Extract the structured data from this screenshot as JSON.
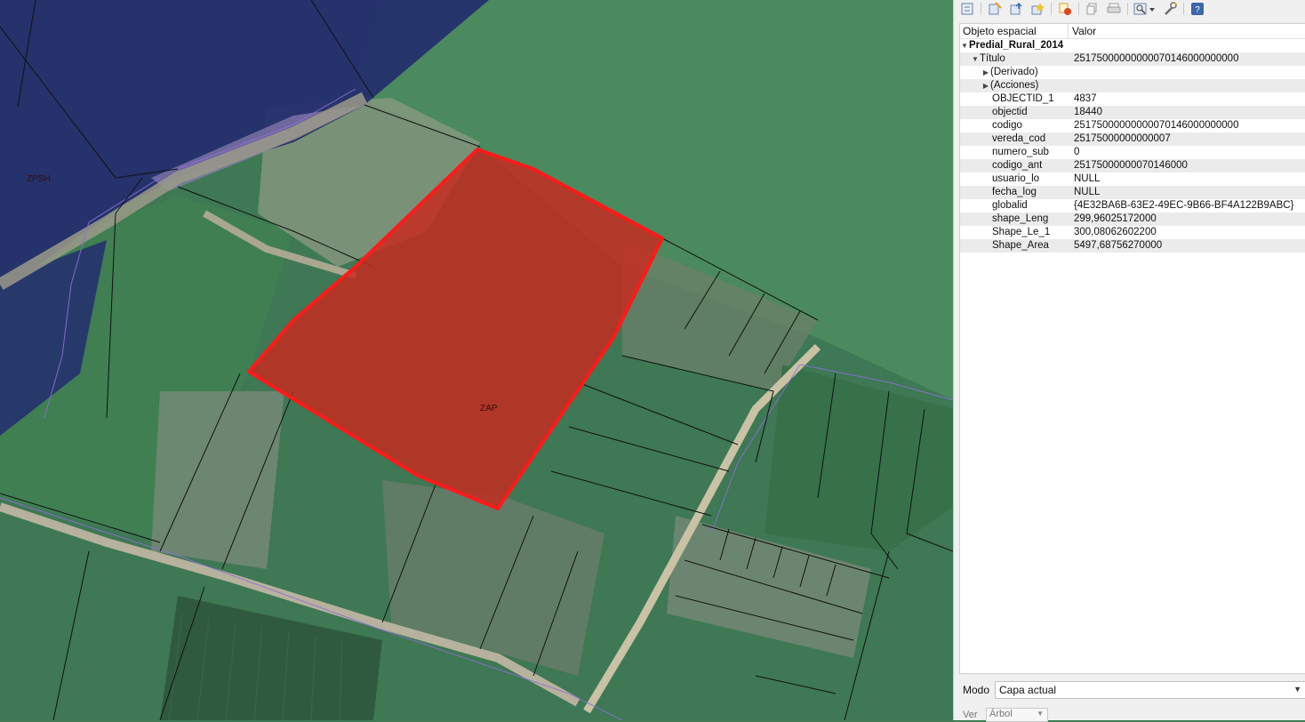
{
  "map": {
    "label_zpsh": "ZPSH",
    "label_zap": "ZAP",
    "colors": {
      "pasture": "#3f7a55",
      "pasture_light": "#4b8a5d",
      "protected_zone": "#1f2a6b",
      "selected_fill": "#c8281e",
      "selected_stroke": "#ff0000",
      "road": "#b9b39a"
    }
  },
  "toolbar": {
    "icons": [
      "expand-tree-icon",
      "expand-new-icon",
      "collapse-icon",
      "highlight-icon",
      "deselect-icon",
      "copy-icon",
      "print-icon",
      "identify-mode-icon",
      "settings-wrench-icon",
      "help-icon"
    ]
  },
  "identify": {
    "col_feature": "Objeto espacial",
    "col_value": "Valor",
    "layer_name": "Predial_Rural_2014",
    "title_key": "Título",
    "title_value": "25175000000000070146000000000",
    "derived": "(Derivado)",
    "actions": "(Acciones)",
    "attributes": [
      {
        "key": "OBJECTID_1",
        "value": "4837"
      },
      {
        "key": "objectid",
        "value": "18440"
      },
      {
        "key": "codigo",
        "value": "25175000000000070146000000000"
      },
      {
        "key": "vereda_cod",
        "value": "25175000000000007"
      },
      {
        "key": "numero_sub",
        "value": "0"
      },
      {
        "key": "codigo_ant",
        "value": "25175000000070146000"
      },
      {
        "key": "usuario_lo",
        "value": "NULL"
      },
      {
        "key": "fecha_log",
        "value": "NULL"
      },
      {
        "key": "globalid",
        "value": "{4E32BA6B-63E2-49EC-9B66-BF4A122B9ABC}"
      },
      {
        "key": "shape_Leng",
        "value": "299,96025172000"
      },
      {
        "key": "Shape_Le_1",
        "value": "300,08062602200"
      },
      {
        "key": "Shape_Area",
        "value": "5497,68756270000"
      }
    ]
  },
  "mode": {
    "label": "Modo",
    "value": "Capa actual"
  },
  "view": {
    "label": "Ver",
    "value": "Árbol"
  }
}
